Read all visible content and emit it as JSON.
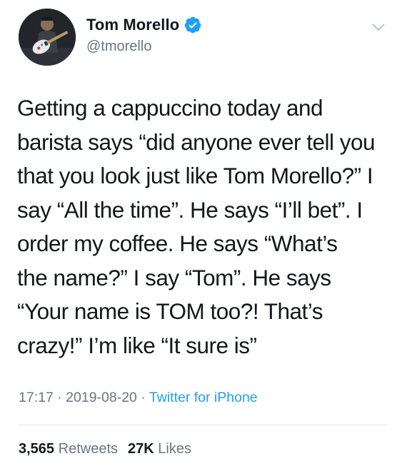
{
  "author": {
    "display_name": "Tom Morello",
    "handle": "@tmorello",
    "verified": true
  },
  "tweet": {
    "text": "Getting a cappuccino today and\nbarista says “did anyone ever tell you\nthat you look just like Tom Morello?” I\nsay “All the time”. He says “I’ll bet”. I\norder my coffee. He says “What’s\nthe name?”  I say “Tom”. He says\n“Your name is TOM too?! That’s\ncrazy!”  I’m like “It sure is”",
    "time": "17:17",
    "separator": "·",
    "date": "2019-08-20",
    "source": "Twitter for iPhone"
  },
  "stats": {
    "retweets_count": "3,565",
    "retweets_label": "Retweets",
    "likes_count": "27K",
    "likes_label": "Likes"
  },
  "icons": {
    "verified": "verified-badge-icon",
    "menu": "chevron-down-icon"
  },
  "colors": {
    "link": "#1da1f2",
    "secondary_text": "#657786",
    "primary_text": "#14171a"
  }
}
